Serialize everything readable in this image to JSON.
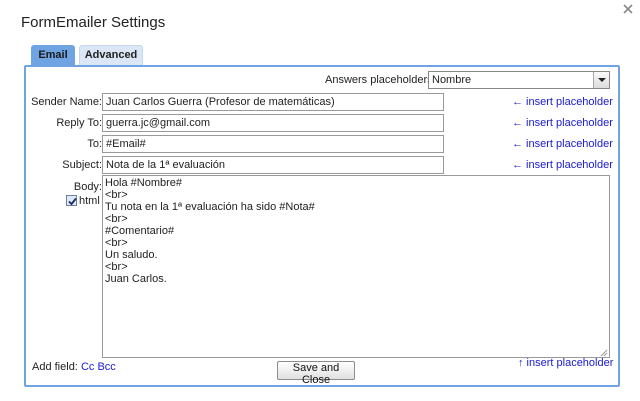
{
  "dialog": {
    "title": "FormEmailer Settings"
  },
  "tabs": [
    {
      "label": "Email",
      "active": true
    },
    {
      "label": "Advanced",
      "active": false
    }
  ],
  "placeholders": {
    "label": "Answers placeholders:",
    "selected": "Nombre"
  },
  "fields": {
    "sender_name": {
      "label": "Sender Name:",
      "value": "Juan Carlos Guerra (Profesor de matemáticas)"
    },
    "reply_to": {
      "label": "Reply To:",
      "value": "guerra.jc@gmail.com"
    },
    "to": {
      "label": "To:",
      "value": "#Email#"
    },
    "subject": {
      "label": "Subject:",
      "value": "Nota de la 1ª evaluación"
    }
  },
  "insert_link": "← insert placeholder",
  "insert_link_body": "↑ insert placeholder",
  "body": {
    "label": "Body:",
    "html_label": "html",
    "html_checked": true,
    "lines": [
      "Hola #Nombre#",
      "<br>",
      "Tu nota en la 1ª evaluación ha sido #Nota#",
      "<br>",
      "#Comentario#",
      "<br>",
      "Un saludo.",
      "<br>",
      "Juan Carlos."
    ]
  },
  "add_field": {
    "label": "Add field:",
    "cc": "Cc",
    "bcc": "Bcc"
  },
  "save_button": "Save and Close",
  "colors": {
    "accent": "#6fa3e2",
    "link": "#1a1ad0"
  }
}
